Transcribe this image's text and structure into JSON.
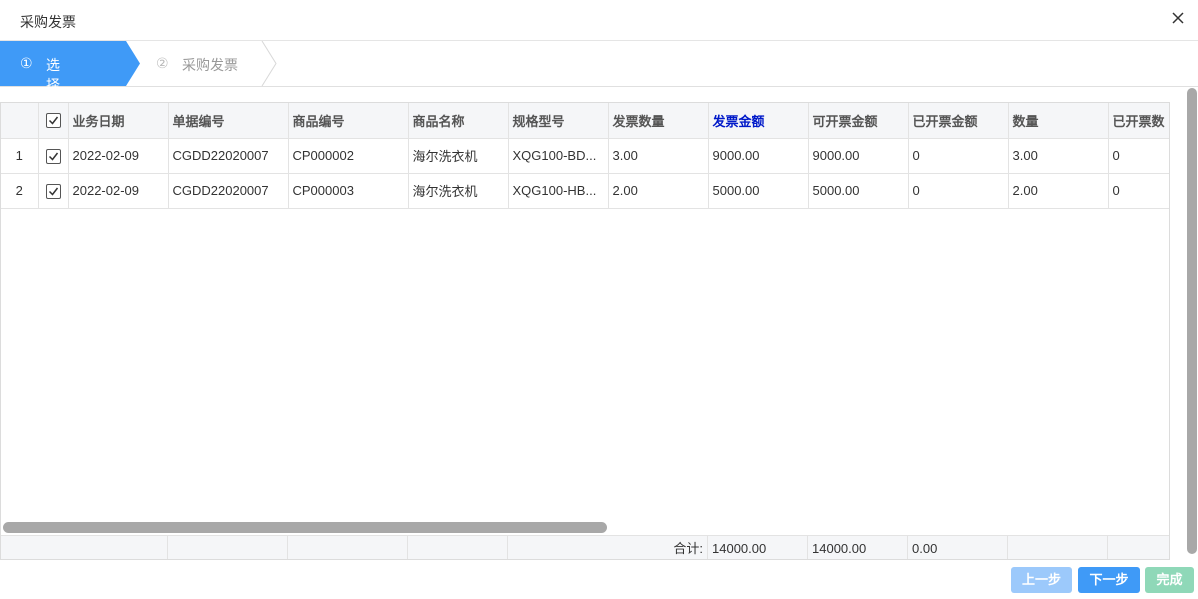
{
  "dialog": {
    "title": "采购发票"
  },
  "steps": [
    {
      "num": "①",
      "label": "选择数据",
      "active": true
    },
    {
      "num": "②",
      "label": "采购发票",
      "active": false
    }
  ],
  "table": {
    "columns": [
      "业务日期",
      "单据编号",
      "商品编号",
      "商品名称",
      "规格型号",
      "发票数量",
      "发票金额",
      "可开票金额",
      "已开票金额",
      "数量",
      "已开票数"
    ],
    "rows": [
      {
        "index": "1",
        "checked": true,
        "cells": [
          "2022-02-09",
          "CGDD22020007",
          "CP000002",
          "海尔洗衣机",
          "XQG100-BD...",
          "3.00",
          "9000.00",
          "9000.00",
          "0",
          "3.00",
          "0"
        ]
      },
      {
        "index": "2",
        "checked": true,
        "cells": [
          "2022-02-09",
          "CGDD22020007",
          "CP000003",
          "海尔洗衣机",
          "XQG100-HB...",
          "2.00",
          "5000.00",
          "5000.00",
          "0",
          "2.00",
          "0"
        ]
      }
    ],
    "footer": {
      "total_label": "合计:",
      "invoice_amount": "14000.00",
      "invoiceable_amount": "14000.00",
      "invoiced_amount": "0.00"
    }
  },
  "buttons": {
    "prev": "上一步",
    "next": "下一步",
    "done": "完成"
  },
  "colors": {
    "active_step": "#3f9af7",
    "highlight_header": "#0019c9",
    "next_button": "#3f9af7",
    "prev_button": "#9cc9fb",
    "done_button": "#8fd8b8"
  }
}
